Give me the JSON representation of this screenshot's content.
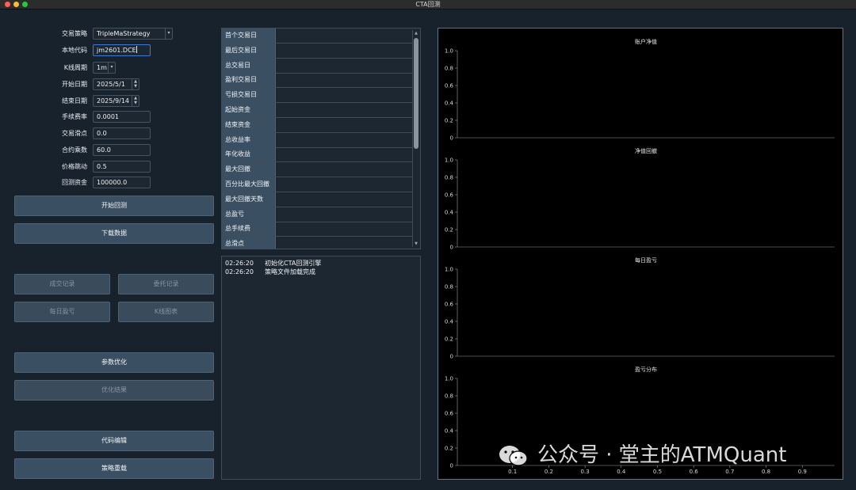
{
  "window": {
    "title": "CTA回测"
  },
  "form": {
    "strategy_label": "交易策略",
    "strategy_value": "TripleMaStrategy",
    "symbol_label": "本地代码",
    "symbol_value": "jm2601.DCE",
    "interval_label": "K线周期",
    "interval_value": "1m",
    "start_label": "开始日期",
    "start_value": "2025/5/1",
    "end_label": "结束日期",
    "end_value": "2025/9/14",
    "rate_label": "手续费率",
    "rate_value": "0.0001",
    "slippage_label": "交易滑点",
    "slippage_value": "0.0",
    "size_label": "合约乘数",
    "size_value": "60.0",
    "pricetick_label": "价格跳动",
    "pricetick_value": "0.5",
    "capital_label": "回测资金",
    "capital_value": "100000.0"
  },
  "buttons": {
    "start_backtest": "开始回测",
    "download_data": "下载数据",
    "trade_records": "成交记录",
    "order_records": "委托记录",
    "daily_pnl": "每日盈亏",
    "kline_chart": "K线图表",
    "optimize": "参数优化",
    "optimize_result": "优化结果",
    "edit_code": "代码编辑",
    "reload_strategy": "策略重载"
  },
  "stats_table": {
    "rows": [
      "首个交易日",
      "最后交易日",
      "总交易日",
      "盈利交易日",
      "亏损交易日",
      "起始资金",
      "结束资金",
      "总收益率",
      "年化收益",
      "最大回撤",
      "百分比最大回撤",
      "最大回撤天数",
      "总盈亏",
      "总手续费",
      "总滑点"
    ]
  },
  "log": [
    {
      "time": "02:26:20",
      "msg": "初始化CTA回测引擎"
    },
    {
      "time": "02:26:20",
      "msg": "策略文件加载完成"
    }
  ],
  "charts": [
    {
      "title": "账户净值",
      "yticks": [
        "1.0",
        "0.8",
        "0.6",
        "0.4",
        "0.2",
        "0"
      ]
    },
    {
      "title": "净值回撤",
      "yticks": [
        "1.0",
        "0.8",
        "0.6",
        "0.4",
        "0.2",
        "0"
      ]
    },
    {
      "title": "每日盈亏",
      "yticks": [
        "1.0",
        "0.8",
        "0.6",
        "0.4",
        "0.2",
        "0"
      ]
    },
    {
      "title": "盈亏分布",
      "yticks": [
        "1.0",
        "0.8",
        "0.6",
        "0.4",
        "0.2",
        "0"
      ],
      "xticks": [
        "0.1",
        "0.2",
        "0.3",
        "0.4",
        "0.5",
        "0.6",
        "0.7",
        "0.8",
        "0.9"
      ]
    }
  ],
  "watermark": {
    "text": "公众号 · 堂主的ATMQuant",
    "icon": "wechat-icon"
  },
  "colors": {
    "background": "#18222d",
    "button": "#3b4f62",
    "chart_bg": "#000000",
    "focus": "#3b7bd6"
  }
}
